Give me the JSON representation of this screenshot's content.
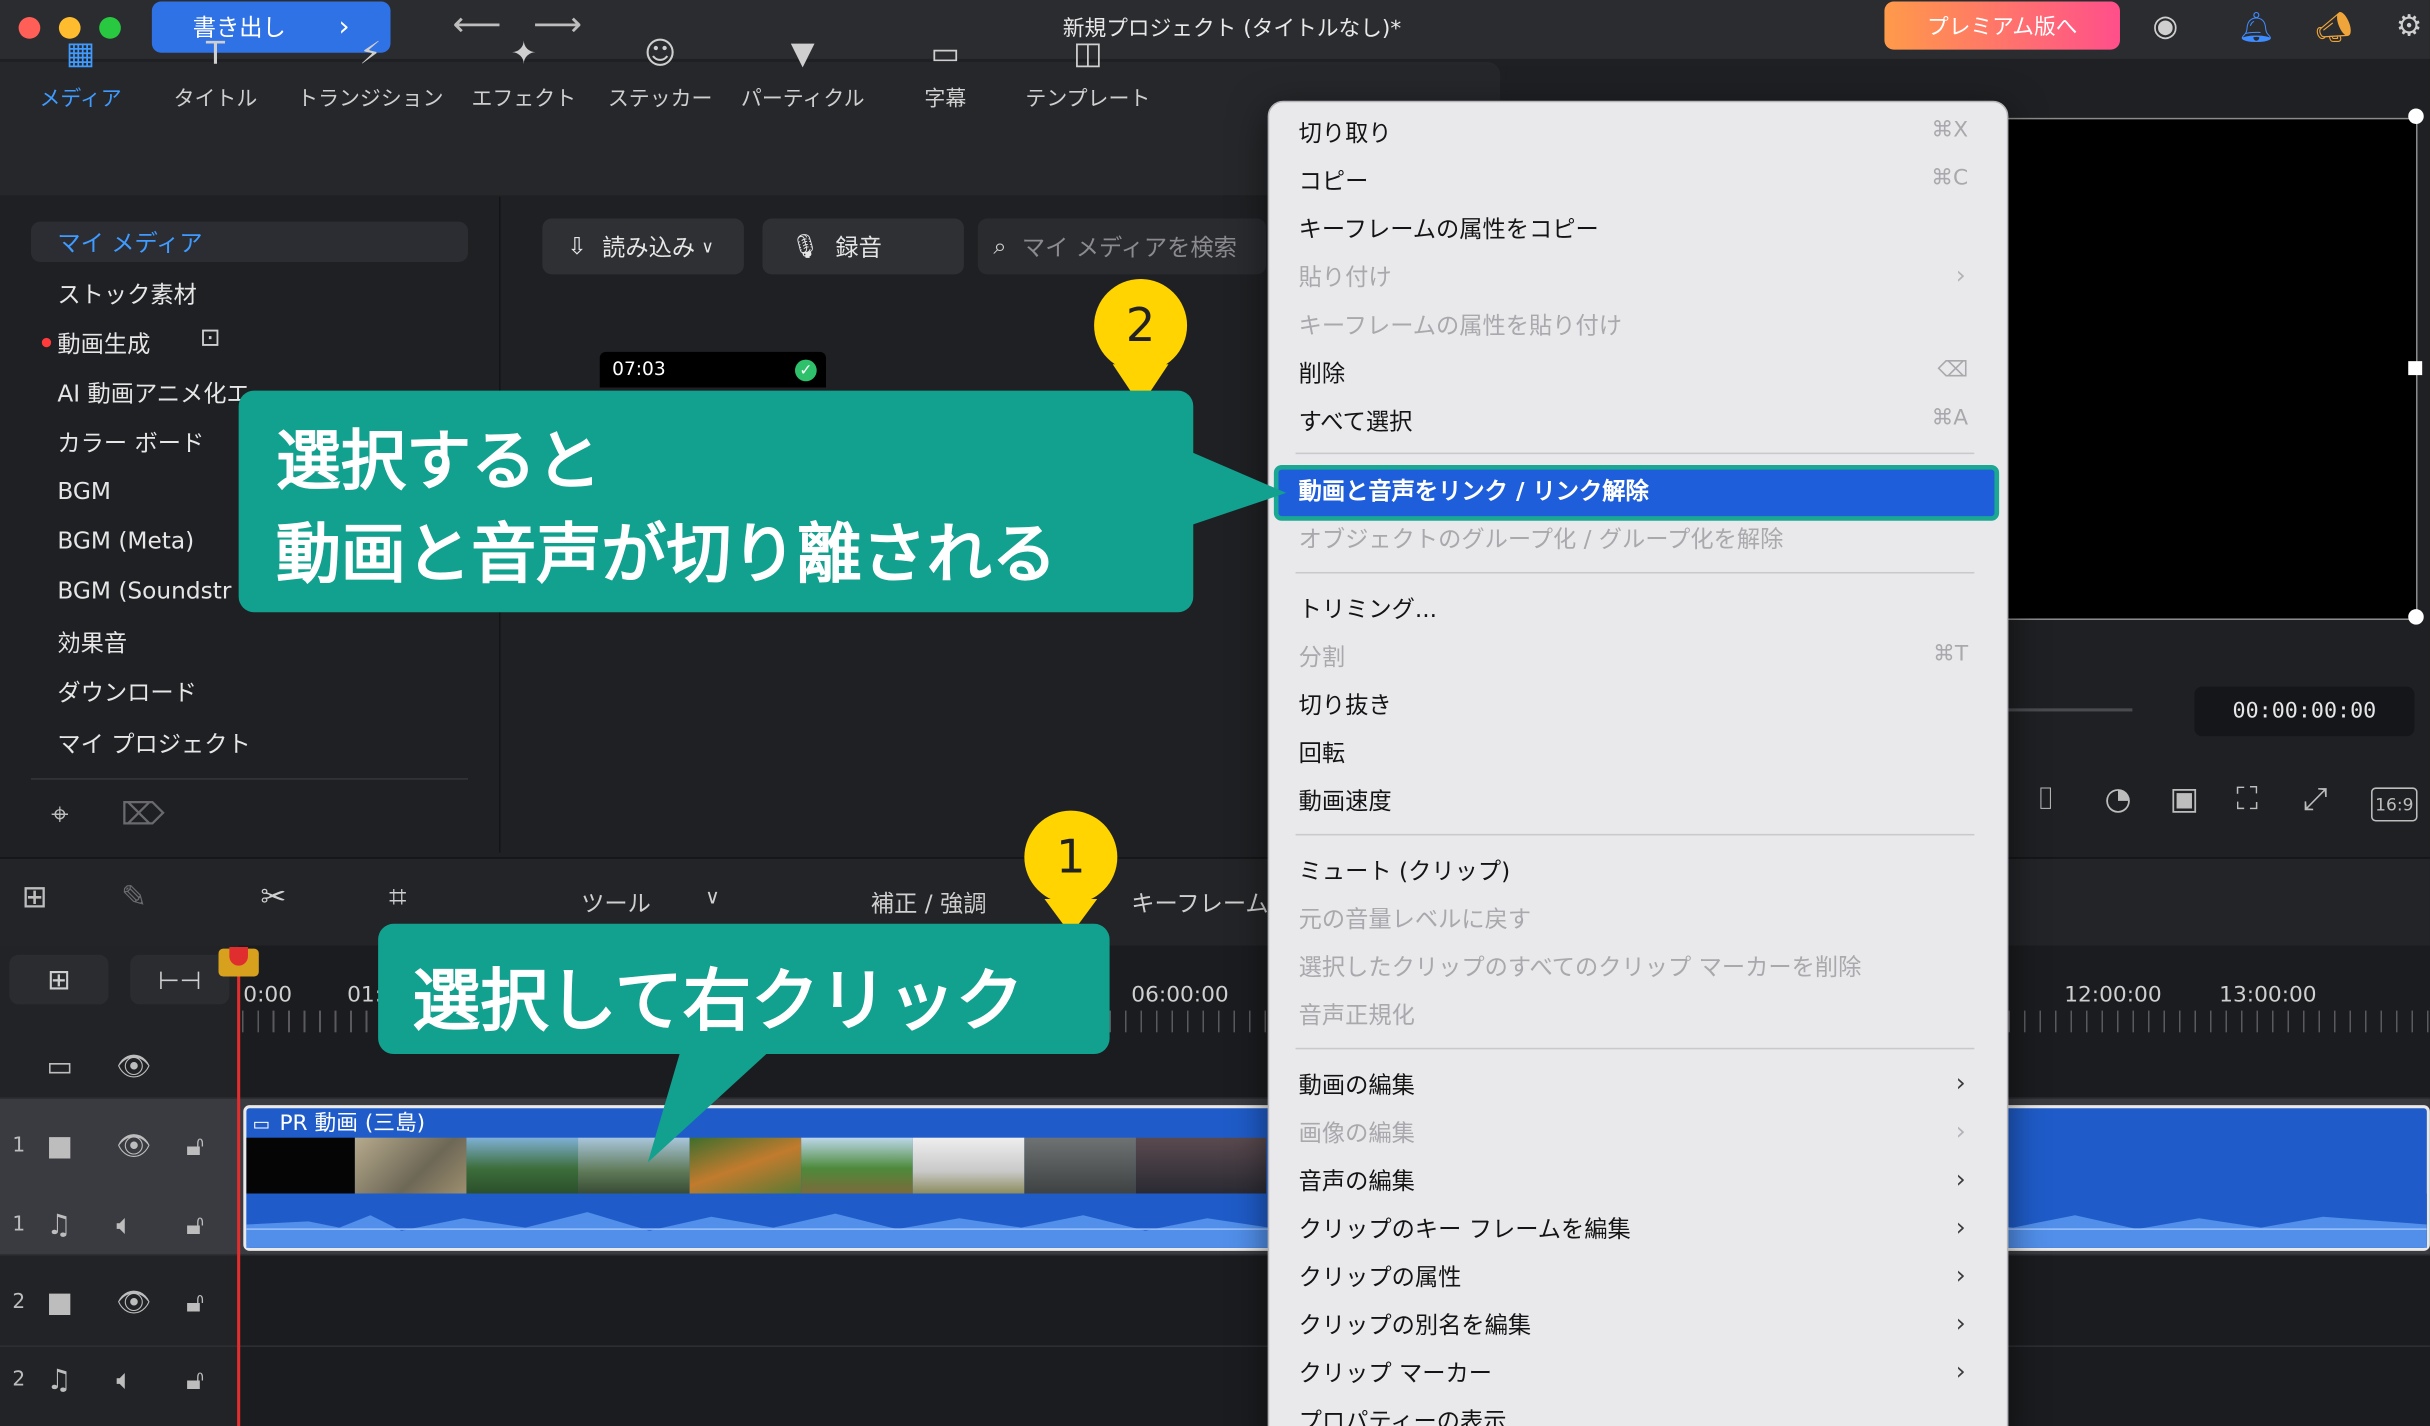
{
  "window": {
    "title": "新規プロジェクト (タイトルなし)*",
    "export_label": "書き出し",
    "premium_label": "プレミアム版へ"
  },
  "toolbar": {
    "tabs": [
      {
        "label": "メディア",
        "icon": "media-icon",
        "active": true
      },
      {
        "label": "タイトル",
        "icon": "title-icon"
      },
      {
        "label": "トランジション",
        "icon": "transition-icon"
      },
      {
        "label": "エフェクト",
        "icon": "effect-icon"
      },
      {
        "label": "ステッカー",
        "icon": "sticker-icon"
      },
      {
        "label": "パーティクル",
        "icon": "particle-icon"
      },
      {
        "label": "字幕",
        "icon": "subtitle-icon"
      },
      {
        "label": "テンプレート",
        "icon": "template-icon"
      }
    ]
  },
  "sidebar": {
    "items": [
      {
        "label": "マイ メディア",
        "active": true
      },
      {
        "label": "ストック素材"
      },
      {
        "label": "動画生成"
      },
      {
        "label": "AI 動画アニメ化エ..."
      },
      {
        "label": "カラー ボード"
      },
      {
        "label": "BGM"
      },
      {
        "label": "BGM (Meta)"
      },
      {
        "label": "BGM (Soundstr"
      },
      {
        "label": "効果音"
      },
      {
        "label": "ダウンロード"
      },
      {
        "label": "マイ プロジェクト"
      }
    ]
  },
  "media": {
    "import_label": "読み込み",
    "record_label": "録音",
    "search_placeholder": "マイ メディアを検索",
    "clip_duration": "07:03"
  },
  "preview": {
    "timecode": "00:00:00:00",
    "aspect": "16:9"
  },
  "timeline": {
    "tools_label": "ツール",
    "correction_label": "補正 / 強調",
    "keyframe_label": "キーフレーム",
    "ruler": [
      "0:00",
      "01:",
      "06:00:00",
      "12:00:00",
      "13:00:00"
    ],
    "clip_title": "PR 動画 (三島)",
    "track_numbers": [
      "1",
      "1",
      "2",
      "2"
    ]
  },
  "context_menu": {
    "items": [
      {
        "label": "切り取り",
        "shortcut": "⌘X"
      },
      {
        "label": "コピー",
        "shortcut": "⌘C"
      },
      {
        "label": "キーフレームの属性をコピー"
      },
      {
        "label": "貼り付け",
        "disabled": true,
        "submenu": true
      },
      {
        "label": "キーフレームの属性を貼り付け",
        "disabled": true
      },
      {
        "label": "削除",
        "shortcut": "⌫"
      },
      {
        "label": "すべて選択",
        "shortcut": "⌘A"
      },
      {
        "label": "動画と音声をリンク / リンク解除",
        "highlighted": true
      },
      {
        "label": "オブジェクトのグループ化 / グループ化を解除",
        "disabled": true
      },
      {
        "label": "トリミング..."
      },
      {
        "label": "分割",
        "shortcut": "⌘T",
        "disabled": true
      },
      {
        "label": "切り抜き"
      },
      {
        "label": "回転"
      },
      {
        "label": "動画速度"
      },
      {
        "label": "ミュート (クリップ)"
      },
      {
        "label": "元の音量レベルに戻す",
        "disabled": true
      },
      {
        "label": "選択したクリップのすべてのクリップ マーカーを削除",
        "disabled": true
      },
      {
        "label": "音声正規化",
        "disabled": true
      },
      {
        "label": "動画の編集",
        "submenu": true
      },
      {
        "label": "画像の編集",
        "disabled": true,
        "submenu": true
      },
      {
        "label": "音声の編集",
        "submenu": true
      },
      {
        "label": "クリップのキー フレームを編集",
        "submenu": true
      },
      {
        "label": "クリップの属性",
        "submenu": true
      },
      {
        "label": "クリップの別名を編集",
        "submenu": true
      },
      {
        "label": "クリップ マーカー",
        "submenu": true
      },
      {
        "label": "プロパティーの表示"
      }
    ]
  },
  "annotations": {
    "callout_top_line1": "選択すると",
    "callout_top_line2": "動画と音声が切り離される",
    "callout_bottom": "選択して右クリック",
    "badge_1": "1",
    "badge_2": "2"
  },
  "colors": {
    "accent": "#2f72e6",
    "callout": "#12a08f",
    "badge": "#ffd400",
    "highlight": "#1f5edb",
    "clip": "#1f5cc9"
  }
}
